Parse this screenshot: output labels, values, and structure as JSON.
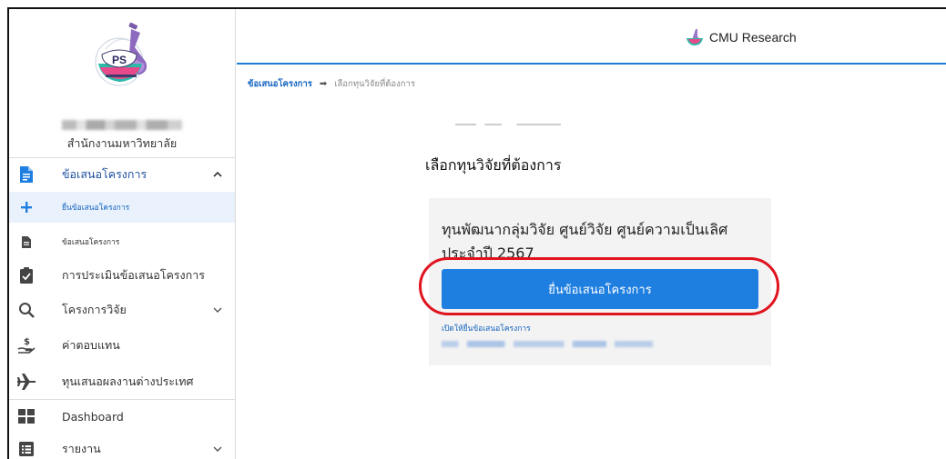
{
  "app": {
    "brand": "CMU Research",
    "top_mark": "ๆ"
  },
  "sidebar": {
    "logo_text": "PS",
    "org_name": "สำนักงานมหาวิทยาลัย",
    "items": [
      {
        "label": "ข้อเสนอโครงการ",
        "icon": "document-icon"
      },
      {
        "label": "ยื่นข้อเสนอโครงการ",
        "icon": "plus-icon"
      },
      {
        "label": "ข้อเสนอโครงการ",
        "icon": "file-icon"
      },
      {
        "label": "การประเมินข้อเสนอโครงการ",
        "icon": "clipboard-check-icon"
      },
      {
        "label": "โครงการวิจัย",
        "icon": "search-icon"
      },
      {
        "label": "ค่าตอบแทน",
        "icon": "hand-money-icon"
      },
      {
        "label": "ทุนเสนอผลงานต่างประเทศ",
        "icon": "airplane-icon"
      },
      {
        "label": "Dashboard",
        "icon": "grid-icon"
      },
      {
        "label": "รายงาน",
        "icon": "list-icon"
      }
    ]
  },
  "breadcrumb": {
    "parent": "ข้อเสนอโครงการ",
    "current": "เลือกทุนวิจัยที่ต้องการ"
  },
  "main": {
    "title": "เลือกทุนวิจัยที่ต้องการ",
    "card": {
      "title": "ทุนพัฒนากลุ่มวิจัย ศูนย์วิจัย ศูนย์ความเป็นเลิศ ประจำปี 2567",
      "submit_label": "ยื่นข้อเสนอโครงการ",
      "open_label": "เปิดให้ยื่นข้อเสนอโครงการ"
    }
  },
  "colors": {
    "accent": "#1e7fe0",
    "highlight": "#e0141e",
    "link": "#1565c0"
  }
}
